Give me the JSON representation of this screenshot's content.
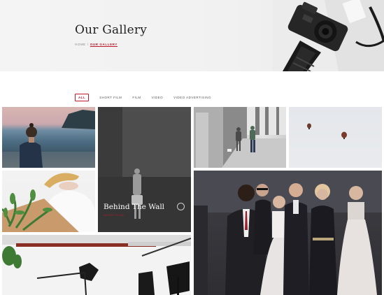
{
  "header": {
    "title": "Our Gallery",
    "breadcrumb": {
      "home": "HOME",
      "separator": "/",
      "current": "OUR GALLERY"
    }
  },
  "filters": [
    {
      "label": "ALL",
      "active": true
    },
    {
      "label": "SHORT FILM",
      "active": false
    },
    {
      "label": "FILM",
      "active": false
    },
    {
      "label": "VIDEO",
      "active": false
    },
    {
      "label": "VIDEO ADVERTISING",
      "active": false
    }
  ],
  "gallery": {
    "featured": {
      "title": "Behind The Wall",
      "subtitle": "SHORT FILM"
    }
  },
  "colors": {
    "accent": "#c0182b",
    "hero_bg": "#f2f2f2",
    "text": "#222222"
  }
}
